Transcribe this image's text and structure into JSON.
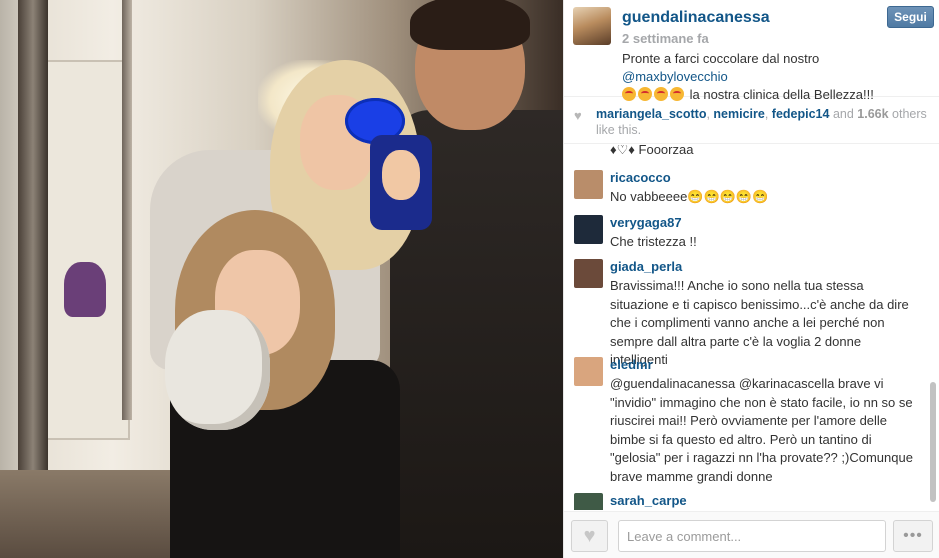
{
  "post": {
    "username": "guendalinacanessa",
    "time_ago": "2 settimane fa",
    "follow_label": "Segui",
    "caption_prefix": "Pronte a farci coccolare dal nostro ",
    "caption_mention": "@maxbylovecchio",
    "caption_suffix": " la nostra clinica della Bellezza!!!",
    "caption_emoji_count": 4
  },
  "likes": {
    "users": [
      "mariangela_scotto",
      "nemicire",
      "fedepic14"
    ],
    "sep1": ", ",
    "sep2": ", ",
    "and_text": " and ",
    "count": "1.66k",
    "suffix": " others like this."
  },
  "comments": {
    "partial_text": "♦♡♦ Fooorzaa",
    "items": [
      {
        "user": "ricacocco",
        "text": "No vabbeeee😁😁😁😁😁",
        "avatar_color": "#b98d6a"
      },
      {
        "user": "verygaga87",
        "text": "Che tristezza !!",
        "avatar_color": "#1e2a3a"
      },
      {
        "user": "giada_perla",
        "text": "Bravissima!!! Anche io sono nella tua stessa situazione e ti capisco benissimo...c'è anche da dire che i complimenti vanno anche a lei perché non sempre dall altra parte c'è la voglia 2 donne intelligenti",
        "avatar_color": "#6b4a3a"
      },
      {
        "user": "eledmr",
        "text": "@guendalinacanessa @karinacascella brave vi \"invidio\" immagino che non è stato facile, io nn so se riuscirei mai!! Però ovviamente per l'amore delle bimbe si fa questo ed altro. Però un tantino di \"gelosia\" per i ragazzi nn l'ha provate?? ;)Comunque brave mamme grandi donne",
        "avatar_color": "#d9a57e"
      },
      {
        "user": "sarah_carpe",
        "text": "",
        "avatar_color": "#3f5a46"
      }
    ]
  },
  "footer": {
    "comment_placeholder": "Leave a comment...",
    "more_label": "•••",
    "like_icon": "heart-icon"
  },
  "colors": {
    "link": "#125688",
    "muted": "#a5a7aa",
    "follow_bg": "#4f7aa3"
  }
}
